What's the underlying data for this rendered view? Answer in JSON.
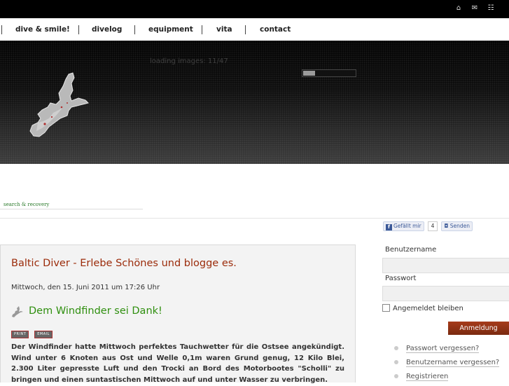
{
  "topbar": {
    "icons": [
      "home-icon",
      "mail-icon",
      "sitemap-icon"
    ]
  },
  "nav": {
    "items": [
      "dive & smile!",
      "divelog",
      "equipment",
      "vita",
      "contact"
    ]
  },
  "hero": {
    "loading_text": "loading images: 11/47",
    "progress": 0.234
  },
  "search_link": "search & recovery",
  "facebook": {
    "like_label": "Gefällt mir",
    "like_count": "4",
    "send_label": "Senden",
    "brand_color": "#3b5998"
  },
  "article": {
    "title": "Baltic Diver - Erlebe Schönes und blogge es.",
    "date": "Mittwoch, den 15. Juni 2011 um 17:26 Uhr",
    "subtitle": "Dem Windfinder sei Dank!",
    "print_label": "PRINT",
    "email_label": "EMAIL",
    "body": "Der Windfinder hatte Mittwoch perfektes Tauchwetter für die Ostsee angekündigt. Wind unter 6 Knoten aus Ost und Welle 0,1m waren Grund genug, 12 Kilo Blei, 2.300 Liter gepresste Luft und den Trocki an Bord des Motorbootes \"Scholli\" zu bringen und einen suntastischen Mittwoch auf und unter Wasser zu verbringen.",
    "title_color": "#9b2b0a",
    "subtitle_color": "#2f8f0f"
  },
  "login": {
    "username_label": "Benutzername",
    "username_value": "",
    "password_label": "Passwort",
    "password_value": "",
    "remember_label": "Angemeldet bleiben",
    "submit_label": "Anmeldung",
    "links": [
      "Passwort vergessen?",
      "Benutzername vergessen?",
      "Registrieren"
    ],
    "accent_color": "#8f3214"
  }
}
